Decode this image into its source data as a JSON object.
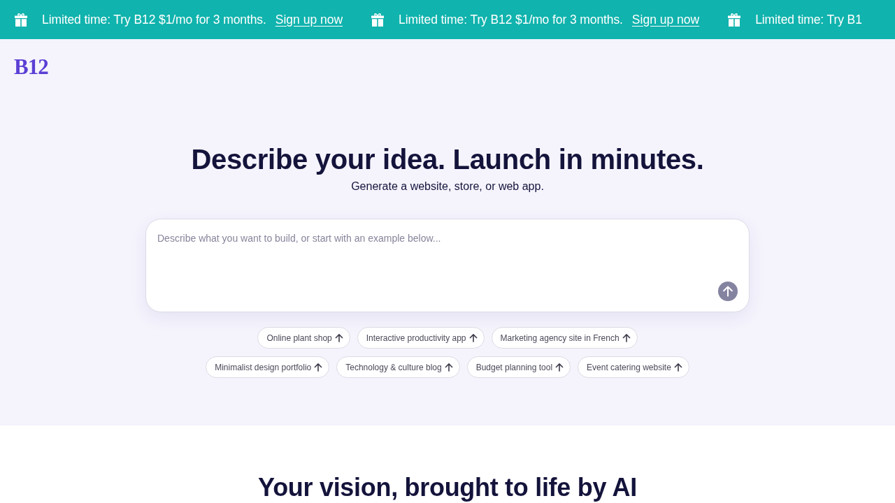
{
  "promo_banner": {
    "items": [
      {
        "text": "Limited time: Try B12 $1/mo for 3 months.",
        "link": "Sign up now"
      },
      {
        "text": "Limited time: Try B12 $1/mo for 3 months.",
        "link": "Sign up now"
      },
      {
        "text": "Limited time: Try B1"
      }
    ]
  },
  "header": {
    "logo": "B12"
  },
  "hero": {
    "title": "Describe your idea. Launch in minutes.",
    "subtitle": "Generate a website, store, or web app.",
    "prompt": {
      "placeholder": "Describe what you want to build, or start with an example below..."
    },
    "suggestion_rows": [
      [
        "Online plant shop",
        "Interactive productivity app",
        "Marketing agency site in French"
      ],
      [
        "Minimalist design portfolio",
        "Technology & culture blog",
        "Budget planning tool",
        "Event catering website"
      ]
    ]
  },
  "features": {
    "title": "Your vision, brought to life by AI"
  }
}
